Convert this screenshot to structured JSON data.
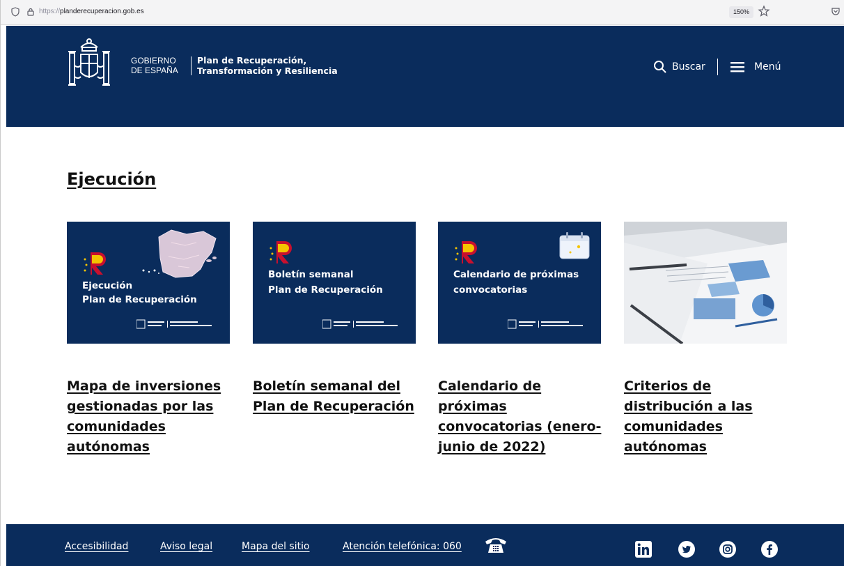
{
  "browser": {
    "url_protocol": "https://",
    "url_host": "planderecuperacion.gob.es",
    "zoom": "150%"
  },
  "header": {
    "gobierno_line1": "GOBIERNO",
    "gobierno_line2": "DE ESPAÑA",
    "plan_line1": "Plan de Recuperación,",
    "plan_line2": "Transformación y Resiliencia",
    "search_label": "Buscar",
    "menu_label": "Menú"
  },
  "section": {
    "title": "Ejecución"
  },
  "cards": [
    {
      "image_label_1": "Ejecución",
      "image_label_2": "Plan de Recuperación",
      "title": "Mapa de inversiones gestionadas por las comunidades autónomas"
    },
    {
      "image_label_1": "Boletín semanal",
      "image_label_2": "Plan de Recuperación",
      "title": "Boletín semanal del Plan de Recuperación"
    },
    {
      "image_label_1": "Calendario de próximas",
      "image_label_2": "convocatorias",
      "title": "Calendario de próximas convocatorias (enero-junio de 2022)"
    },
    {
      "title": "Criterios de distribución a las comunidades autónomas"
    }
  ],
  "footer": {
    "links": [
      "Accesibilidad",
      "Aviso legal",
      "Mapa del sitio",
      "Atención telefónica: 060"
    ],
    "social": [
      "linkedin-icon",
      "twitter-icon",
      "instagram-icon",
      "facebook-icon"
    ]
  },
  "colors": {
    "brand_navy": "#0a2c5c",
    "logo_red": "#c8102e",
    "logo_yellow": "#f5c400"
  }
}
